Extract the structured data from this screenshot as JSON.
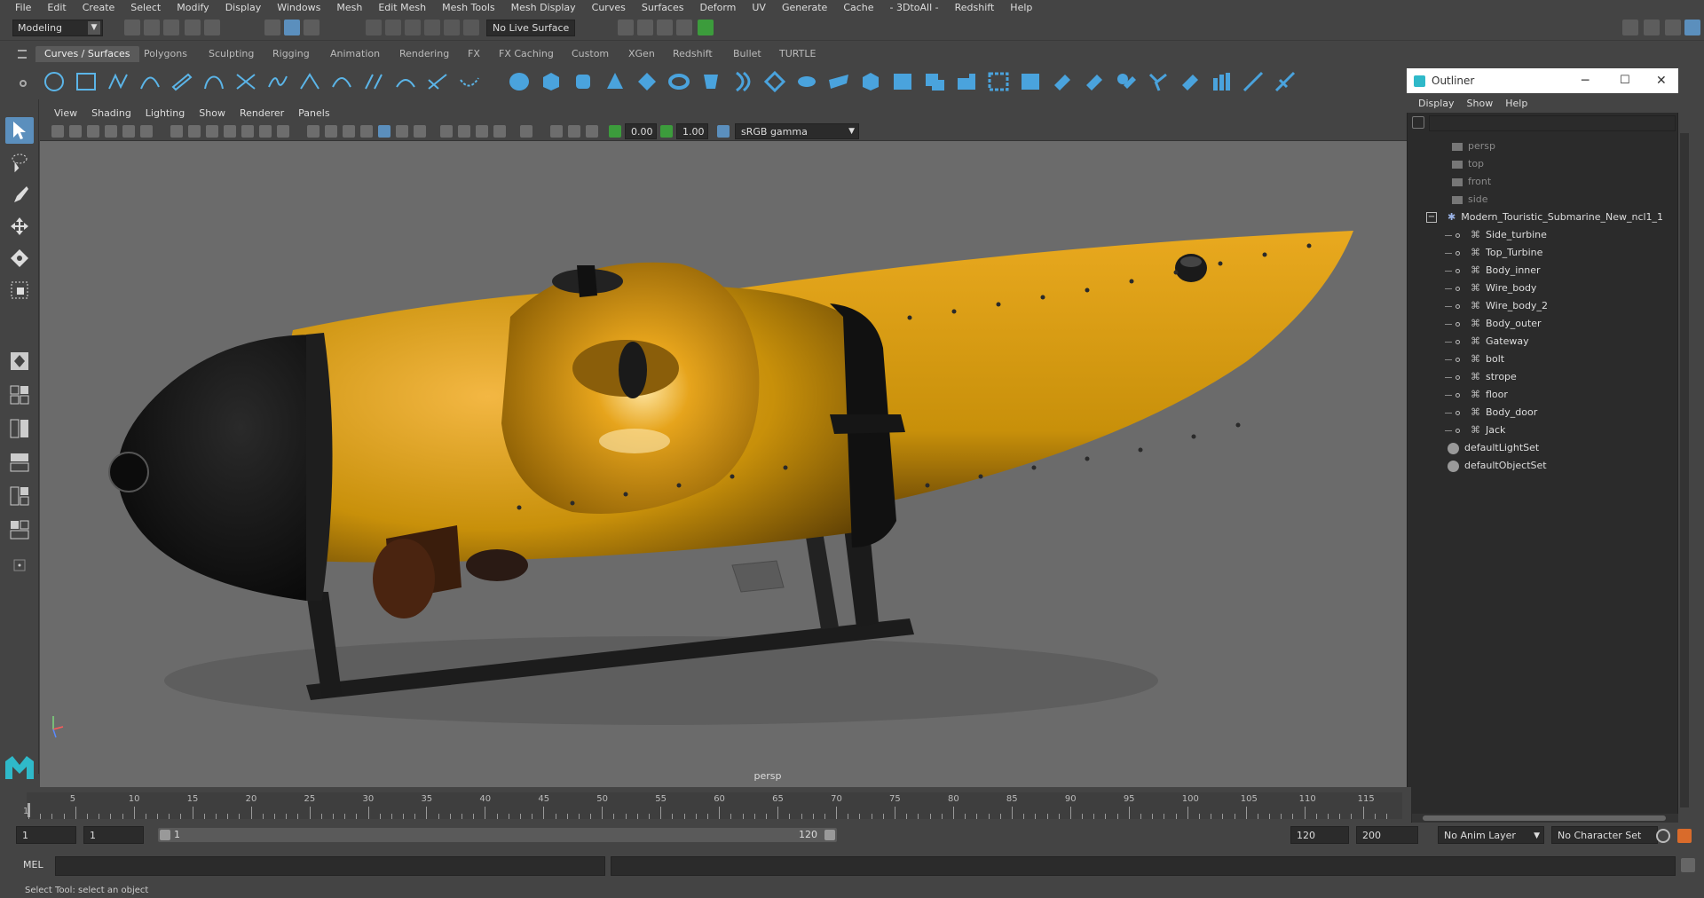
{
  "menubar": {
    "items": [
      "File",
      "Edit",
      "Create",
      "Select",
      "Modify",
      "Display",
      "Windows",
      "Mesh",
      "Edit Mesh",
      "Mesh Tools",
      "Mesh Display",
      "Curves",
      "Surfaces",
      "Deform",
      "UV",
      "Generate",
      "Cache",
      "- 3DtoAll -",
      "Redshift",
      "Help"
    ]
  },
  "statusline": {
    "mode": "Modeling",
    "live_surface": "No Live Surface"
  },
  "shelf": {
    "tabs": [
      "Curves / Surfaces",
      "Polygons",
      "Sculpting",
      "Rigging",
      "Animation",
      "Rendering",
      "FX",
      "FX Caching",
      "Custom",
      "XGen",
      "Redshift",
      "Bullet",
      "TURTLE"
    ],
    "active_tab": "Curves / Surfaces"
  },
  "viewport": {
    "menu": [
      "View",
      "Shading",
      "Lighting",
      "Show",
      "Renderer",
      "Panels"
    ],
    "near_value": "0.00",
    "far_value": "1.00",
    "color_space": "sRGB gamma",
    "camera_label": "persp"
  },
  "outliner": {
    "title": "Outliner",
    "menu": [
      "Display",
      "Show",
      "Help"
    ],
    "cameras": [
      "persp",
      "top",
      "front",
      "side"
    ],
    "root": "Modern_Touristic_Submarine_New_ncl1_1",
    "children": [
      "Side_turbine",
      "Top_Turbine",
      "Body_inner",
      "Wire_body",
      "Wire_body_2",
      "Body_outer",
      "Gateway",
      "bolt",
      "strope",
      "floor",
      "Body_door",
      "Jack"
    ],
    "sets": [
      "defaultLightSet",
      "defaultObjectSet"
    ]
  },
  "timeline": {
    "ticks": [
      "1",
      "5",
      "10",
      "15",
      "20",
      "25",
      "30",
      "35",
      "40",
      "45",
      "50",
      "55",
      "60",
      "65",
      "70",
      "75",
      "80",
      "85",
      "90",
      "95",
      "100",
      "105",
      "110",
      "115"
    ],
    "start_frame": "1",
    "current_frame": "1",
    "range_start_label": "1",
    "range_end_label": "120",
    "end_frame": "120",
    "max_frame": "200",
    "anim_layer": "No Anim Layer",
    "character_set": "No Character Set"
  },
  "cmdline": {
    "label": "MEL"
  },
  "helpline": {
    "text": "Select Tool: select an object"
  },
  "colors": {
    "hull": "#c8900a",
    "accent": "#5b8fbd",
    "background": "#444444"
  }
}
